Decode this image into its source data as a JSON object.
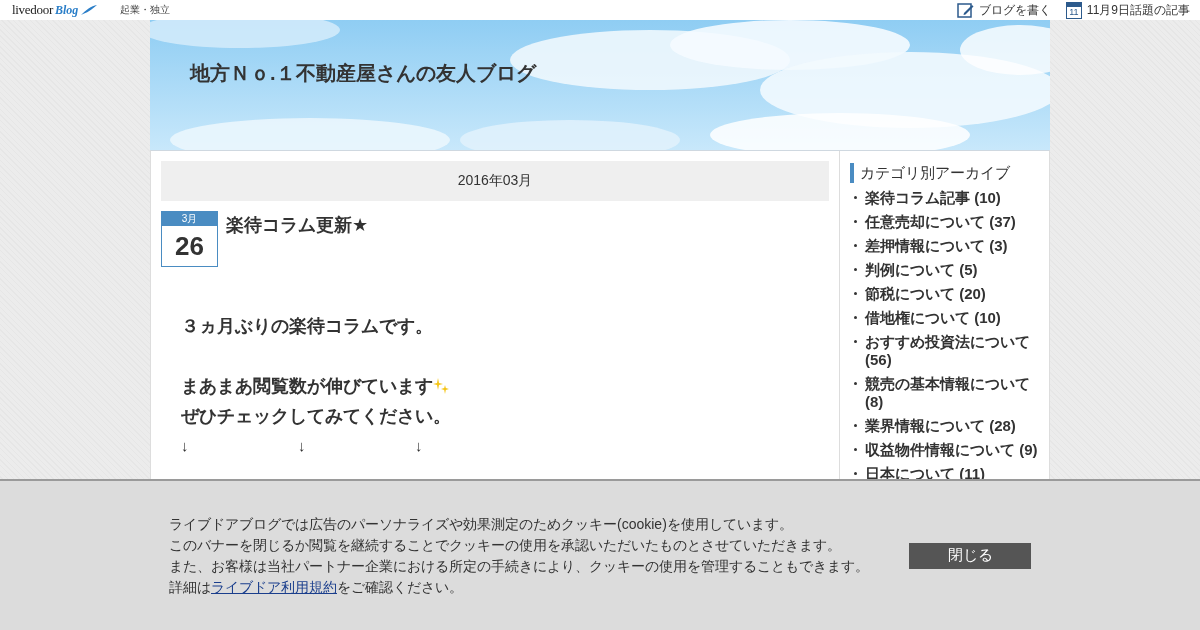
{
  "topbar": {
    "logo": "livedoor",
    "logo_script": "Blog",
    "category": "起業・独立",
    "links": [
      {
        "kind": "write",
        "label": "ブログを書く"
      },
      {
        "kind": "calendar",
        "label": "11月9日話題の記事",
        "icon_text": "11"
      }
    ]
  },
  "header": {
    "kind": "picture",
    "title": "地方Ｎｏ.１不動産屋さんの友人ブログ"
  },
  "main": {
    "month_heading": "2016年03月",
    "post": {
      "date_month": "3月",
      "date_day": "26",
      "title": "楽待コラム更新★",
      "body": [
        {
          "kind": "text",
          "text": "３ヵ月ぶりの楽待コラムです。"
        },
        {
          "kind": "blank"
        },
        {
          "kind": "sparkle",
          "text": "まあまあ閲覧数が伸びています"
        },
        {
          "kind": "text",
          "text": "ぜひチェックしてみてください。"
        },
        {
          "kind": "arrows",
          "items": [
            "↓",
            "↓",
            "↓"
          ]
        }
      ]
    }
  },
  "sidebar": {
    "heading": "カテゴリ別アーカイブ",
    "items": [
      {
        "label": "楽待コラム記事",
        "count": "(10)"
      },
      {
        "label": "任意売却について",
        "count": "(37)"
      },
      {
        "label": "差押情報について",
        "count": "(3)"
      },
      {
        "label": "判例について",
        "count": "(5)"
      },
      {
        "label": "節税について",
        "count": "(20)"
      },
      {
        "label": "借地権について",
        "count": "(10)"
      },
      {
        "label": "おすすめ投資法について",
        "count": "(56)"
      },
      {
        "label": "競売の基本情報について",
        "count": "(8)"
      },
      {
        "label": "業界情報について",
        "count": "(28)"
      },
      {
        "label": "収益物件情報について",
        "count": "(9)"
      },
      {
        "label": "日本について",
        "count": "(11)"
      }
    ]
  },
  "cookie_banner": {
    "lines": [
      "ライブドアブログでは広告のパーソナライズや効果測定のためクッキー(cookie)を使用しています。",
      "このバナーを閉じるか閲覧を継続することでクッキーの使用を承認いただいたものとさせていただきます。",
      "また、お客様は当社パートナー企業における所定の手続きにより、クッキーの使用を管理することもできます。"
    ],
    "last_line_before": "詳細は",
    "last_line_link": "ライブドア利用規約",
    "last_line_after": "をご確認ください。",
    "close_button": "閉じる"
  }
}
